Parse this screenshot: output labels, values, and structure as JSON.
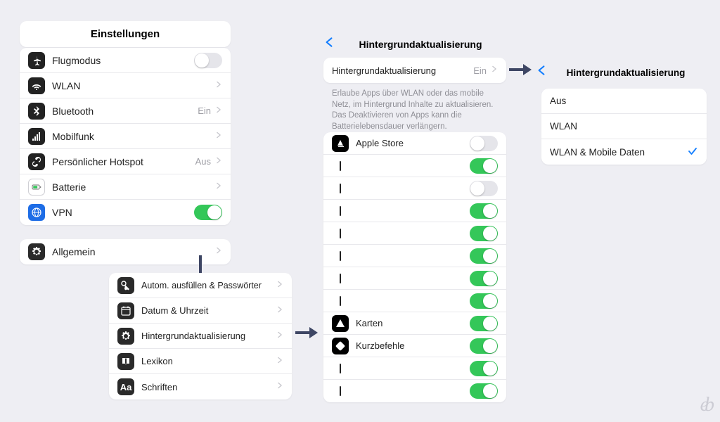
{
  "settings": {
    "title": "Einstellungen",
    "items": [
      {
        "label": "Flugmodus",
        "icon": "airplane",
        "toggle": false
      },
      {
        "label": "WLAN",
        "icon": "wifi",
        "chevron": true
      },
      {
        "label": "Bluetooth",
        "icon": "bluetooth",
        "status": "Ein",
        "chevron": true
      },
      {
        "label": "Mobilfunk",
        "icon": "cellular",
        "chevron": true
      },
      {
        "label": "Persönlicher Hotspot",
        "icon": "hotspot",
        "status": "Aus",
        "chevron": true
      },
      {
        "label": "Batterie",
        "icon": "battery",
        "chevron": true
      },
      {
        "label": "VPN",
        "icon": "vpn",
        "toggle": true
      }
    ],
    "general_label": "Allgemein"
  },
  "general": {
    "items": [
      {
        "label": "Autom. ausfüllen & Passwörter"
      },
      {
        "label": "Datum & Uhrzeit"
      },
      {
        "label": "Hintergrundaktualisierung"
      },
      {
        "label": "Lexikon"
      },
      {
        "label": "Schriften"
      }
    ]
  },
  "refresh": {
    "title": "Hintergrundaktualisierung",
    "master": {
      "label": "Hintergrundaktualisierung",
      "status": "Ein"
    },
    "footnote": "Erlaube Apps über WLAN oder das mobile Netz, im Hintergrund Inhalte zu aktualisieren. Das Deaktivieren von Apps kann die Batterielebens­dauer verlängern.",
    "apps": [
      {
        "label": "Apple Store",
        "icon": "appstore",
        "on": false
      },
      {
        "label": "",
        "on": true
      },
      {
        "label": "",
        "on": false
      },
      {
        "label": "",
        "on": true
      },
      {
        "label": "",
        "on": true
      },
      {
        "label": "",
        "on": true
      },
      {
        "label": "",
        "on": true
      },
      {
        "label": "",
        "on": true
      },
      {
        "label": "Karten",
        "icon": "maps",
        "on": true
      },
      {
        "label": "Kurzbefehle",
        "icon": "shortcuts",
        "on": true
      },
      {
        "label": "",
        "on": true
      },
      {
        "label": "",
        "on": true
      }
    ]
  },
  "options": {
    "title": "Hintergrundaktualisierung",
    "items": [
      {
        "label": "Aus",
        "selected": false
      },
      {
        "label": "WLAN",
        "selected": false
      },
      {
        "label": "WLAN & Mobile Daten",
        "selected": true
      }
    ]
  },
  "watermark": "eb"
}
